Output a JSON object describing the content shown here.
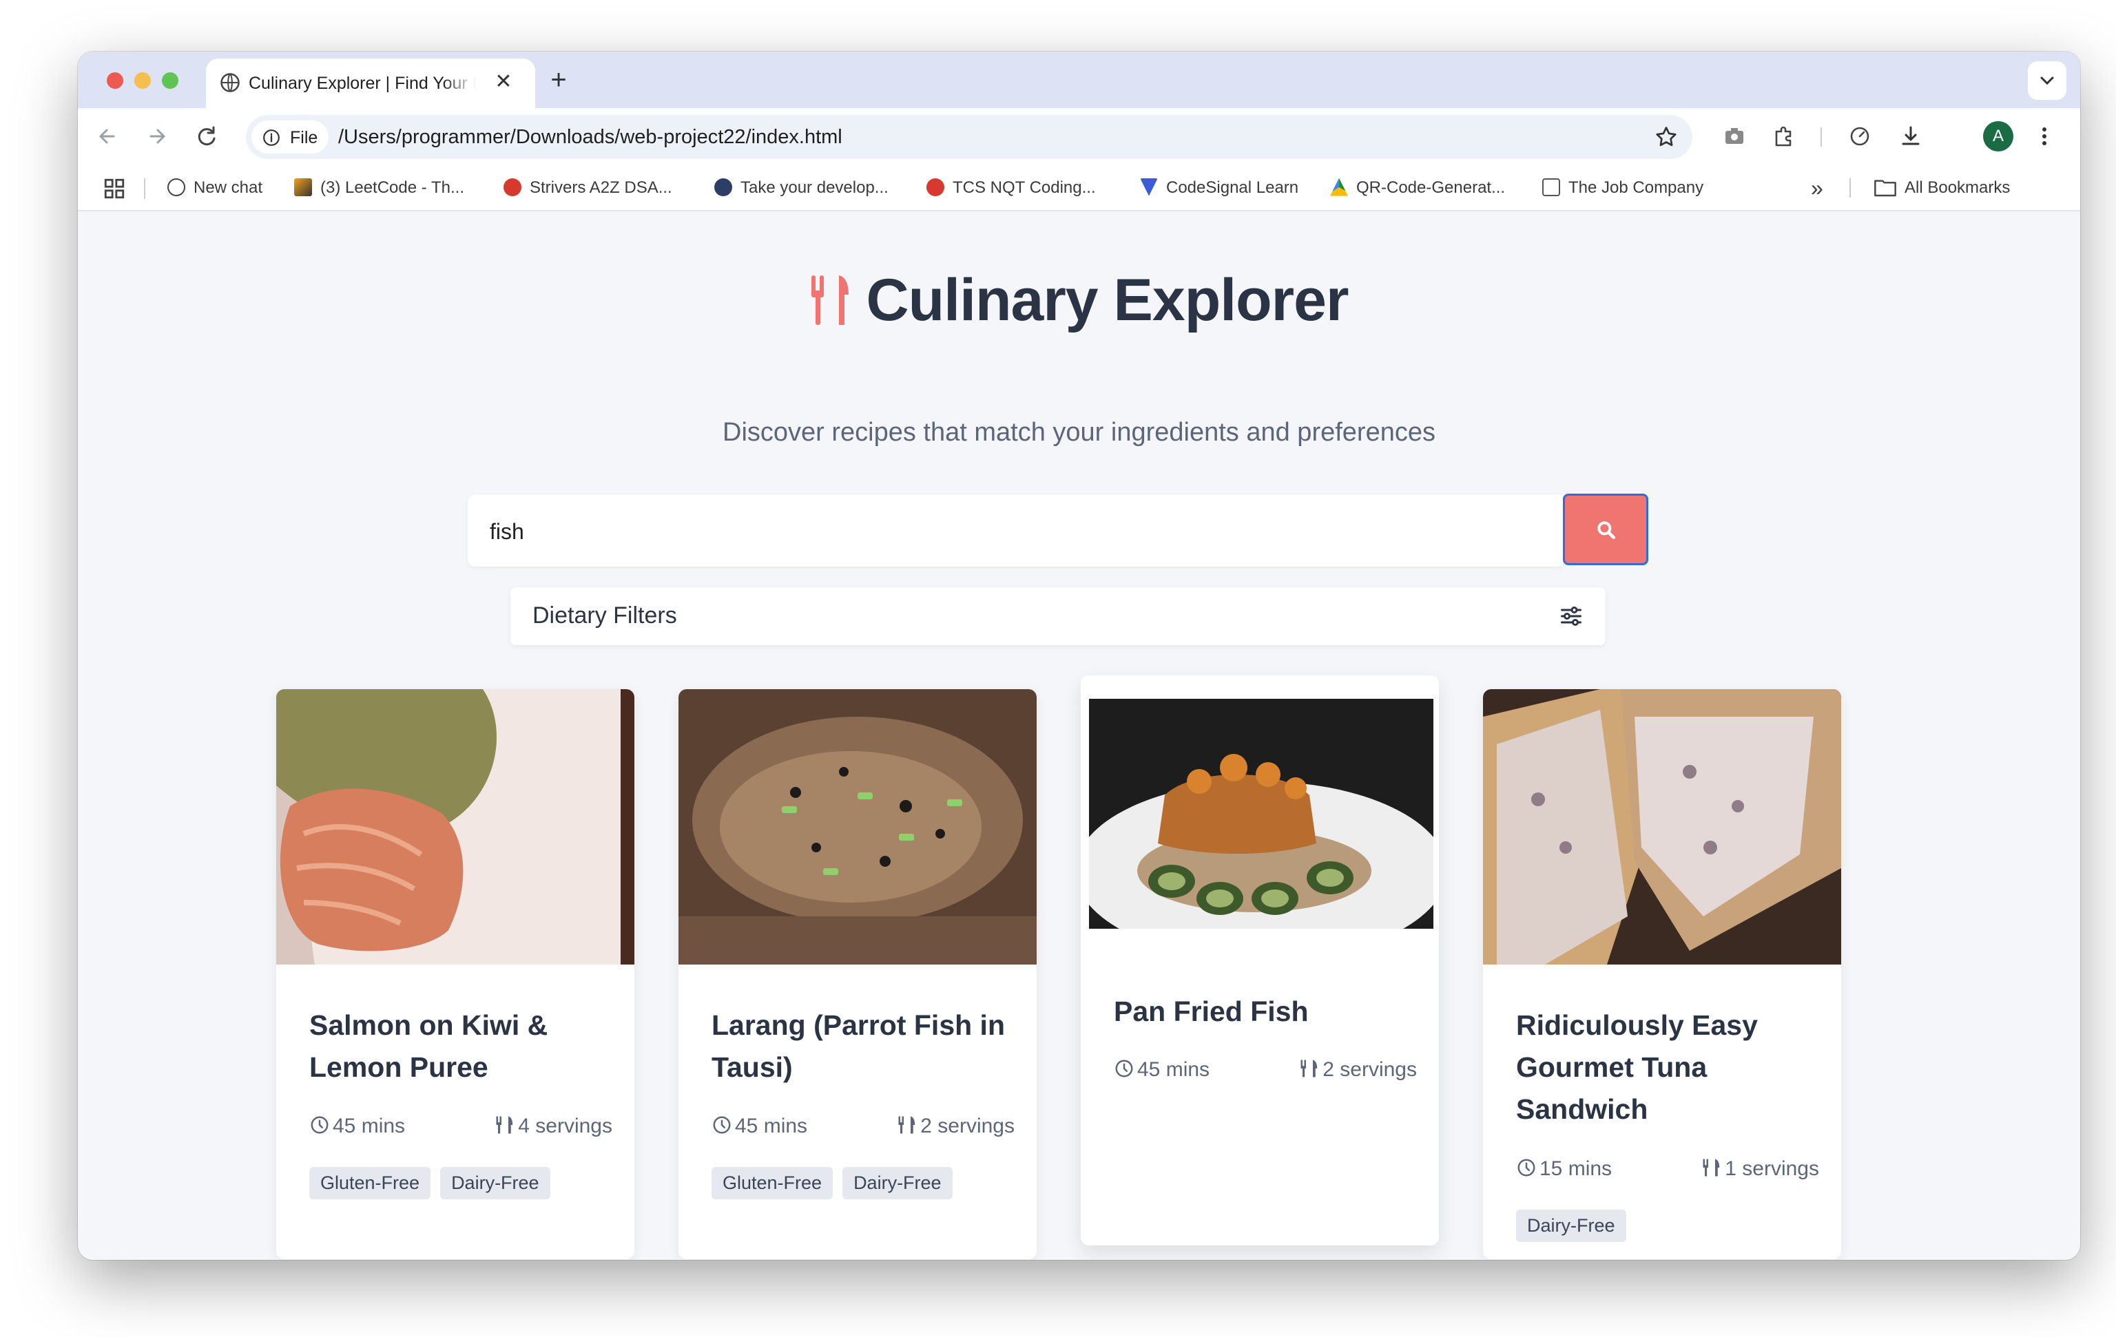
{
  "browser": {
    "tab_title": "Culinary Explorer | Find Your Perfect Recipe",
    "tab_close": "✕",
    "new_tab": "+",
    "file_chip": "File",
    "url": "/Users/programmer/Downloads/web-project22/index.html",
    "avatar_letter": "A",
    "bookmarks": [
      {
        "label": "New chat",
        "icon": "openai-icon"
      },
      {
        "label": "(3) LeetCode - Th...",
        "icon": "leetcode-icon"
      },
      {
        "label": "Strivers A2Z DSA...",
        "icon": "tuf-icon"
      },
      {
        "label": "Take your develop...",
        "icon": "avatar-icon"
      },
      {
        "label": "TCS NQT Coding...",
        "icon": "tuf-icon"
      },
      {
        "label": "CodeSignal Learn",
        "icon": "codesignal-icon"
      },
      {
        "label": "QR-Code-Generat...",
        "icon": "drive-icon"
      },
      {
        "label": "The Job Company",
        "icon": "briefcase-icon"
      }
    ],
    "bookmarks_overflow": "»",
    "all_bookmarks": "All Bookmarks"
  },
  "hero": {
    "title": "Culinary Explorer",
    "subtitle": "Discover recipes that match your ingredients and preferences"
  },
  "search": {
    "value": "fish"
  },
  "filters": {
    "label": "Dietary Filters"
  },
  "recipes": [
    {
      "title": "Salmon on Kiwi & Lemon Puree",
      "time": "45 mins",
      "servings": "4 servings",
      "tags": [
        "Gluten-Free",
        "Dairy-Free"
      ]
    },
    {
      "title": "Larang (Parrot Fish in Tausi)",
      "time": "45 mins",
      "servings": "2 servings",
      "tags": [
        "Gluten-Free",
        "Dairy-Free"
      ]
    },
    {
      "title": "Pan Fried Fish",
      "time": "45 mins",
      "servings": "2 servings",
      "tags": []
    },
    {
      "title": "Ridiculously Easy Gourmet Tuna Sandwich",
      "time": "15 mins",
      "servings": "1 servings",
      "tags": [
        "Dairy-Free"
      ]
    }
  ],
  "colors": {
    "accent": "#f07470",
    "heading": "#2b3445",
    "page_bg": "#f4f6f9"
  }
}
